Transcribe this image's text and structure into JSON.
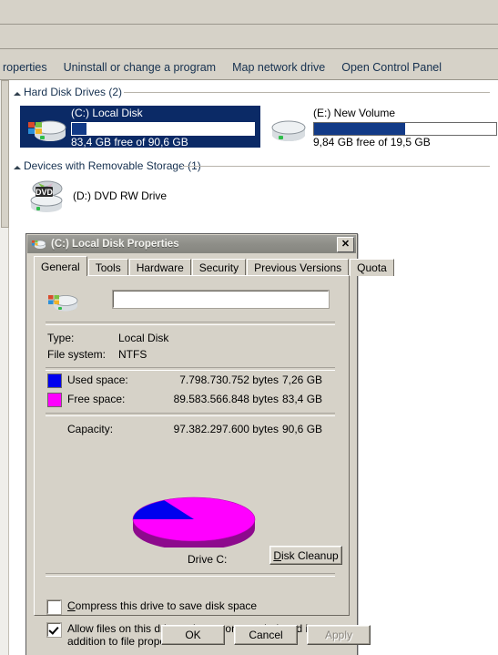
{
  "explorer": {
    "toolbar_items": [
      {
        "label": "roperties",
        "name": "toolbar-properties"
      },
      {
        "label": "Uninstall or change a program",
        "name": "toolbar-uninstall-or-change-a-program"
      },
      {
        "label": "Map network drive",
        "name": "toolbar-map-network-drive"
      },
      {
        "label": "Open Control Panel",
        "name": "toolbar-open-control-panel"
      }
    ],
    "groups": [
      {
        "label": "Hard Disk Drives (2)"
      },
      {
        "label": "Devices with Removable Storage (1)"
      }
    ],
    "drives": [
      {
        "name": "(C:) Local Disk",
        "free_text": "83,4 GB free of 90,6 GB",
        "used_percent": 8,
        "selected": true,
        "icon": "hard-disk-drive-icon"
      },
      {
        "name": "(E:) New Volume",
        "free_text": "9,84 GB free of 19,5 GB",
        "used_percent": 50,
        "selected": false,
        "icon": "hard-disk-drive-icon"
      }
    ],
    "removable": [
      {
        "name": "(D:) DVD RW Drive",
        "icon": "dvd-drive-icon"
      }
    ]
  },
  "dialog": {
    "title": "(C:) Local Disk Properties",
    "close_label": "✕",
    "tabs": [
      {
        "label": "General",
        "active": true
      },
      {
        "label": "Tools",
        "active": false
      },
      {
        "label": "Hardware",
        "active": false
      },
      {
        "label": "Security",
        "active": false
      },
      {
        "label": "Previous Versions",
        "active": false
      },
      {
        "label": "Quota",
        "active": false
      }
    ],
    "volume_label_value": "",
    "info": [
      {
        "label": "Type:",
        "value": "Local Disk"
      },
      {
        "label": "File system:",
        "value": "NTFS"
      }
    ],
    "space": [
      {
        "label": "Used space:",
        "bytes": "7.798.730.752 bytes",
        "size": "7,26 GB",
        "color": "#0000ee"
      },
      {
        "label": "Free space:",
        "bytes": "89.583.566.848 bytes",
        "size": "83,4 GB",
        "color": "#ff00ff"
      }
    ],
    "capacity": {
      "label": "Capacity:",
      "bytes": "97.382.297.600 bytes",
      "size": "90,6 GB"
    },
    "drive_caption": "Drive C:",
    "disk_cleanup_button": {
      "pre": "D",
      "rest": "isk Cleanup"
    },
    "checkboxes": [
      {
        "pre": "C",
        "mid": "ompress this drive to save disk space",
        "checked": false
      },
      {
        "pre": "Allow files on this drive to have contents ",
        "mid": "indexed in addition to file properties",
        "checked": true
      }
    ],
    "buttons": [
      {
        "label": "OK",
        "disabled": false
      },
      {
        "label": "Cancel",
        "disabled": false
      },
      {
        "label": "Apply",
        "disabled": true
      }
    ]
  },
  "chart_data": {
    "type": "pie",
    "title": "Drive C:",
    "labels": [
      "Used space",
      "Free space"
    ],
    "values": [
      7.26,
      83.4
    ],
    "percents": [
      8.0,
      92.0
    ],
    "colors": [
      "#0000ee",
      "#ff00ff"
    ],
    "units": "GB",
    "legend": "left",
    "grid": false,
    "three_d": true,
    "start_angle_deg": 180
  }
}
